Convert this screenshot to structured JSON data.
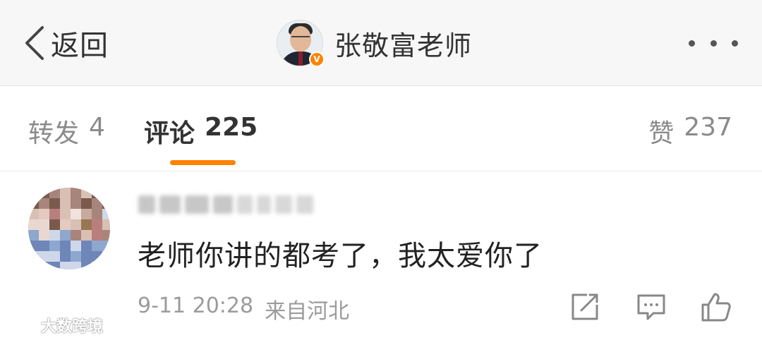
{
  "header": {
    "back_label": "返回",
    "title": "张敬富老师",
    "verified_badge": "V",
    "accent_color": "#ff8200"
  },
  "tabs": {
    "repost": {
      "label": "转发",
      "count": "4"
    },
    "comment": {
      "label": "评论",
      "count": "225"
    },
    "like": {
      "label": "赞",
      "count": "237"
    },
    "active": "comment"
  },
  "comment": {
    "username": "",
    "text": "老师你讲的都考了，我太爱你了",
    "time": "9-11 20:28",
    "source": "来自河北",
    "actions": [
      "share-icon",
      "reply-icon",
      "like-icon"
    ]
  },
  "watermark": {
    "text": "大数跨境"
  }
}
